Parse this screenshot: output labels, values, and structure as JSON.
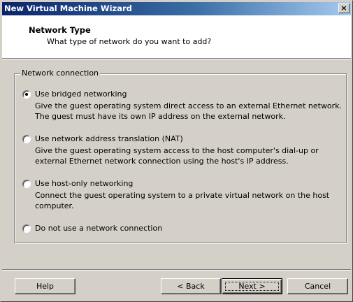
{
  "window": {
    "title": "New Virtual Machine Wizard",
    "close_glyph": "×"
  },
  "header": {
    "title": "Network Type",
    "subtitle": "What type of network do you want to add?"
  },
  "group": {
    "legend": "Network connection",
    "options": [
      {
        "label": "Use bridged networking",
        "description": "Give the guest operating system direct access to an external Ethernet network. The guest must have its own IP address on the external network.",
        "checked": true
      },
      {
        "label": "Use network address translation (NAT)",
        "description": "Give the guest operating system access to the host computer's dial-up or external Ethernet network connection using the host's IP address.",
        "checked": false
      },
      {
        "label": "Use host-only networking",
        "description": "Connect the guest operating system to a private virtual network on the host computer.",
        "checked": false
      },
      {
        "label": "Do not use a network connection",
        "description": "",
        "checked": false
      }
    ]
  },
  "buttons": {
    "help": "Help",
    "back": "< Back",
    "next": "Next >",
    "cancel": "Cancel"
  },
  "colors": {
    "dialog_face": "#d4d0c8",
    "title_start": "#0a246a",
    "title_end": "#a6caf0"
  }
}
